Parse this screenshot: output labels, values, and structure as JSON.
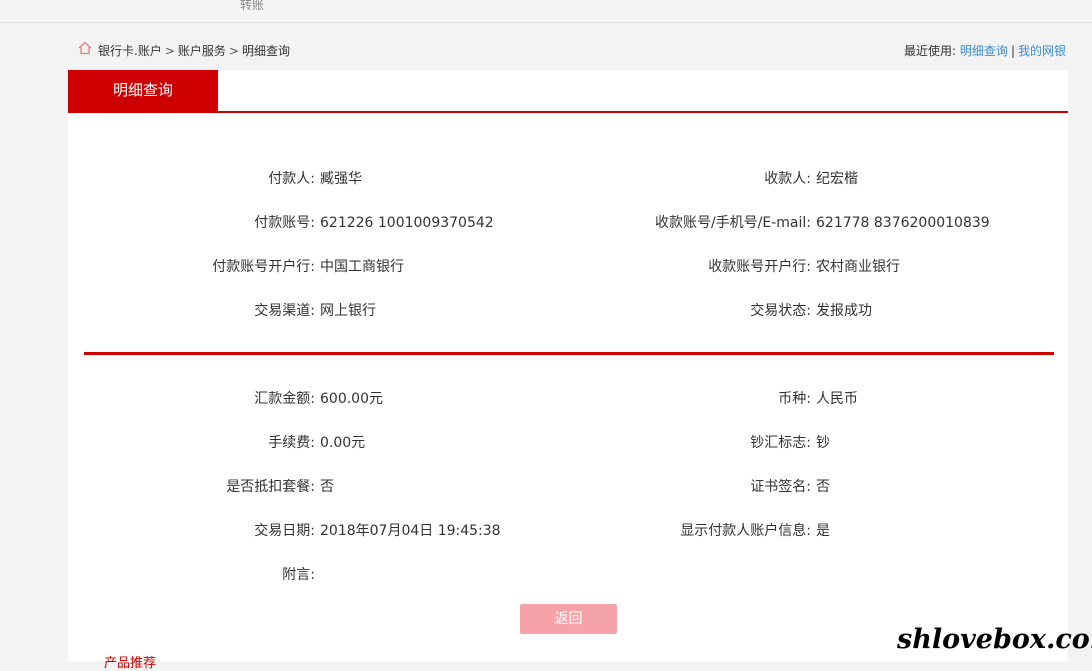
{
  "topbar": {
    "tab_label": "转账"
  },
  "breadcrumb": {
    "items": [
      "银行卡.账户",
      "账户服务",
      "明细查询"
    ],
    "separator": ">",
    "recent_label": "最近使用:",
    "recent_links": [
      "明细查询",
      "我的网银"
    ],
    "recent_divider": "|"
  },
  "panel": {
    "tab_label": "明细查询"
  },
  "section1": {
    "left": [
      {
        "label": "付款人:",
        "value": "臧强华"
      },
      {
        "label": "付款账号:",
        "value": "621226 1001009370542"
      },
      {
        "label": "付款账号开户行:",
        "value": "中国工商银行"
      },
      {
        "label": "交易渠道:",
        "value": "网上银行"
      }
    ],
    "right": [
      {
        "label": "收款人:",
        "value": "纪宏楷"
      },
      {
        "label": "收款账号/手机号/E-mail:",
        "value": "621778 8376200010839"
      },
      {
        "label": "收款账号开户行:",
        "value": "农村商业银行"
      },
      {
        "label": "交易状态:",
        "value": "发报成功"
      }
    ]
  },
  "section2": {
    "left": [
      {
        "label": "汇款金额:",
        "value": "600.00元"
      },
      {
        "label": "手续费:",
        "value": "0.00元"
      },
      {
        "label": "是否抵扣套餐:",
        "value": "否"
      },
      {
        "label": "交易日期:",
        "value": "2018年07月04日 19:45:38"
      },
      {
        "label": "附言:",
        "value": ""
      }
    ],
    "right": [
      {
        "label": "币种:",
        "value": "人民币"
      },
      {
        "label": "钞汇标志:",
        "value": "钞"
      },
      {
        "label": "证书签名:",
        "value": "否"
      },
      {
        "label": "显示付款人账户信息:",
        "value": "是"
      }
    ]
  },
  "actions": {
    "return_label": "返回"
  },
  "footer": {
    "stub_text": "产品推荐"
  },
  "watermark": {
    "text": "shlovebox.com"
  },
  "colors": {
    "brand_red": "#cc0000",
    "link_blue": "#3d8bd3",
    "button_disabled": "#f5a3a8"
  },
  "icons": {
    "home": "home-icon"
  }
}
